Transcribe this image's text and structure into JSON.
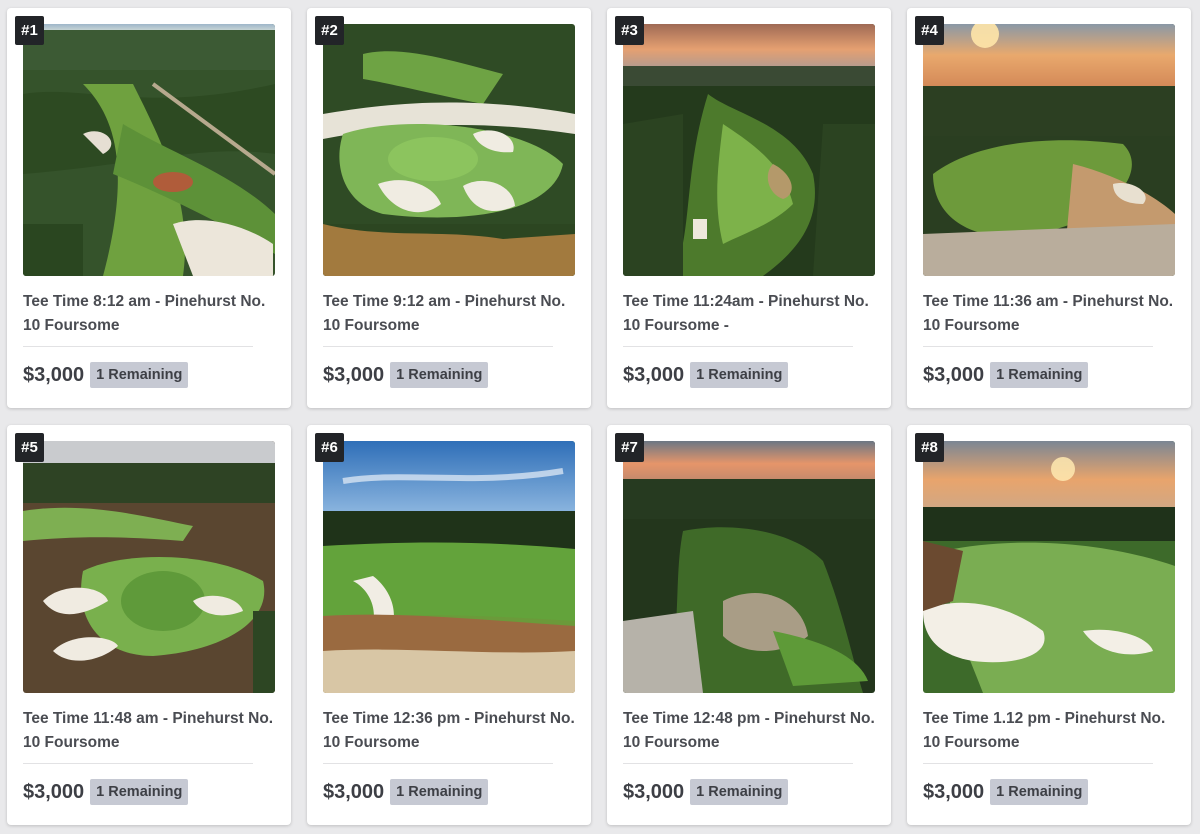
{
  "lots": [
    {
      "number": "#1",
      "title": "Tee Time 8:12 am - Pinehurst No. 10 Foursome",
      "price": "$3,000",
      "remaining": "1 Remaining"
    },
    {
      "number": "#2",
      "title": "Tee Time 9:12 am - Pinehurst No. 10 Foursome",
      "price": "$3,000",
      "remaining": "1 Remaining"
    },
    {
      "number": "#3",
      "title": "Tee Time 11:24am - Pinehurst No. 10 Foursome -",
      "price": "$3,000",
      "remaining": "1 Remaining"
    },
    {
      "number": "#4",
      "title": "Tee Time 11:36 am - Pinehurst No. 10 Foursome",
      "price": "$3,000",
      "remaining": "1 Remaining"
    },
    {
      "number": "#5",
      "title": "Tee Time 11:48 am - Pinehurst No. 10 Foursome",
      "price": "$3,000",
      "remaining": "1 Remaining"
    },
    {
      "number": "#6",
      "title": "Tee Time 12:36 pm - Pinehurst No. 10 Foursome",
      "price": "$3,000",
      "remaining": "1 Remaining"
    },
    {
      "number": "#7",
      "title": "Tee Time 12:48 pm - Pinehurst No. 10 Foursome",
      "price": "$3,000",
      "remaining": "1 Remaining"
    },
    {
      "number": "#8",
      "title": "Tee Time 1.12 pm - Pinehurst No. 10 Foursome",
      "price": "$3,000",
      "remaining": "1 Remaining"
    }
  ]
}
